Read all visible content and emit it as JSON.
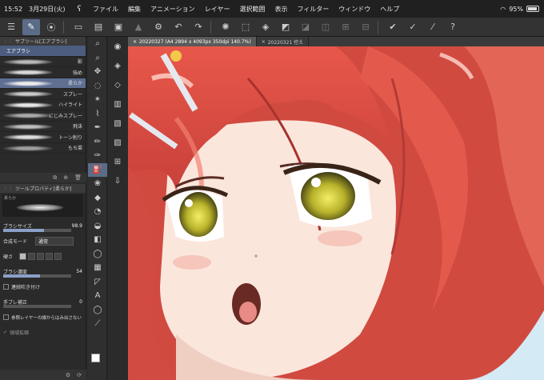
{
  "status": {
    "time": "15:52",
    "date": "3月29日(火)",
    "battery": "95%"
  },
  "menu": [
    "ファイル",
    "編集",
    "アニメーション",
    "レイヤー",
    "選択範囲",
    "表示",
    "フィルター",
    "ウィンドウ",
    "ヘルプ"
  ],
  "subtool": {
    "title": "サブツール[エアブラシ]",
    "category": "エアブラシ",
    "brushes": [
      {
        "name": "影",
        "stroke": "#b8b8b8",
        "selected": false
      },
      {
        "name": "強め",
        "stroke": "#d8d8d8",
        "selected": false
      },
      {
        "name": "柔らか",
        "stroke": "#ececec",
        "selected": true
      },
      {
        "name": "スプレー",
        "stroke": "#c8c8c8",
        "selected": false
      },
      {
        "name": "ハイライト",
        "stroke": "#e6e6e6",
        "selected": false
      },
      {
        "name": "にじみスプレー",
        "stroke": "#a8a8a8",
        "selected": false
      },
      {
        "name": "飛沫",
        "stroke": "#bdbdbd",
        "selected": false
      },
      {
        "name": "トーン削り",
        "stroke": "#dcdcdc",
        "selected": false
      },
      {
        "name": "もち菜",
        "stroke": "#9e9e9e",
        "selected": false
      }
    ]
  },
  "toolprop": {
    "title": "ツールプロパティ[柔らか]",
    "preview_tag": "柔らか",
    "brush_size_label": "ブラシサイズ",
    "brush_size_value": "98.9",
    "brush_size_fraction": 0.6,
    "blend_label": "合成モード",
    "blend_value": "通常",
    "hardness_label": "硬さ",
    "density_label": "ブラシ濃度",
    "density_value": "54",
    "density_fraction": 0.54,
    "continuous_label": "連続吹き付け",
    "stabilization_label": "手ブレ補正",
    "stabilization_value": "0",
    "stabilization_fraction": 0.0,
    "refer_label": "参照レイヤーの線からはみ出さない",
    "expand_label": "領域拡縮"
  },
  "tabs": [
    {
      "label": "20220327 (A4 2894 x 4093px 350dpi 140.7%)",
      "active": true
    },
    {
      "label": "20220321 控え",
      "active": false
    }
  ]
}
